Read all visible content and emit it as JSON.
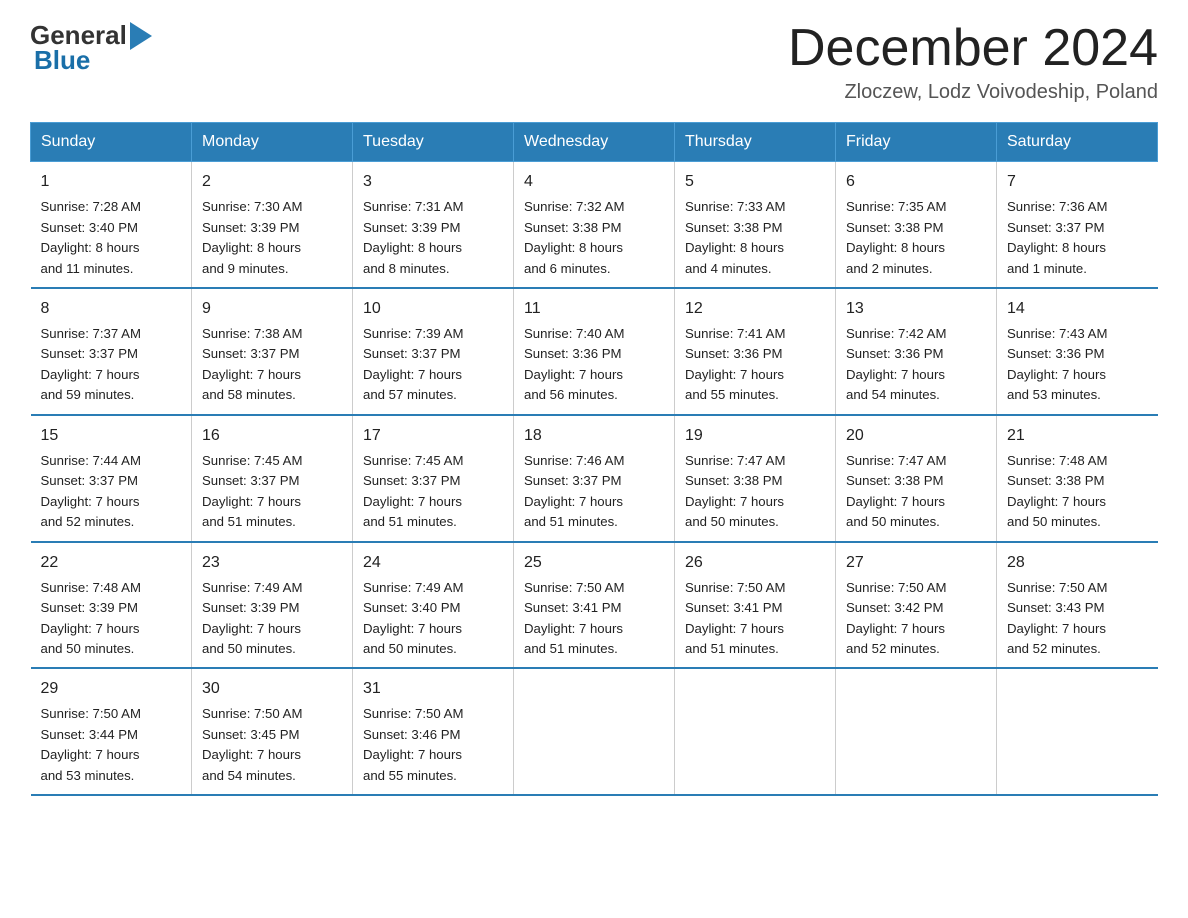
{
  "header": {
    "logo_general": "General",
    "logo_blue": "Blue",
    "month_title": "December 2024",
    "subtitle": "Zloczew, Lodz Voivodeship, Poland"
  },
  "columns": [
    "Sunday",
    "Monday",
    "Tuesday",
    "Wednesday",
    "Thursday",
    "Friday",
    "Saturday"
  ],
  "weeks": [
    [
      {
        "day": "1",
        "info": "Sunrise: 7:28 AM\nSunset: 3:40 PM\nDaylight: 8 hours\nand 11 minutes."
      },
      {
        "day": "2",
        "info": "Sunrise: 7:30 AM\nSunset: 3:39 PM\nDaylight: 8 hours\nand 9 minutes."
      },
      {
        "day": "3",
        "info": "Sunrise: 7:31 AM\nSunset: 3:39 PM\nDaylight: 8 hours\nand 8 minutes."
      },
      {
        "day": "4",
        "info": "Sunrise: 7:32 AM\nSunset: 3:38 PM\nDaylight: 8 hours\nand 6 minutes."
      },
      {
        "day": "5",
        "info": "Sunrise: 7:33 AM\nSunset: 3:38 PM\nDaylight: 8 hours\nand 4 minutes."
      },
      {
        "day": "6",
        "info": "Sunrise: 7:35 AM\nSunset: 3:38 PM\nDaylight: 8 hours\nand 2 minutes."
      },
      {
        "day": "7",
        "info": "Sunrise: 7:36 AM\nSunset: 3:37 PM\nDaylight: 8 hours\nand 1 minute."
      }
    ],
    [
      {
        "day": "8",
        "info": "Sunrise: 7:37 AM\nSunset: 3:37 PM\nDaylight: 7 hours\nand 59 minutes."
      },
      {
        "day": "9",
        "info": "Sunrise: 7:38 AM\nSunset: 3:37 PM\nDaylight: 7 hours\nand 58 minutes."
      },
      {
        "day": "10",
        "info": "Sunrise: 7:39 AM\nSunset: 3:37 PM\nDaylight: 7 hours\nand 57 minutes."
      },
      {
        "day": "11",
        "info": "Sunrise: 7:40 AM\nSunset: 3:36 PM\nDaylight: 7 hours\nand 56 minutes."
      },
      {
        "day": "12",
        "info": "Sunrise: 7:41 AM\nSunset: 3:36 PM\nDaylight: 7 hours\nand 55 minutes."
      },
      {
        "day": "13",
        "info": "Sunrise: 7:42 AM\nSunset: 3:36 PM\nDaylight: 7 hours\nand 54 minutes."
      },
      {
        "day": "14",
        "info": "Sunrise: 7:43 AM\nSunset: 3:36 PM\nDaylight: 7 hours\nand 53 minutes."
      }
    ],
    [
      {
        "day": "15",
        "info": "Sunrise: 7:44 AM\nSunset: 3:37 PM\nDaylight: 7 hours\nand 52 minutes."
      },
      {
        "day": "16",
        "info": "Sunrise: 7:45 AM\nSunset: 3:37 PM\nDaylight: 7 hours\nand 51 minutes."
      },
      {
        "day": "17",
        "info": "Sunrise: 7:45 AM\nSunset: 3:37 PM\nDaylight: 7 hours\nand 51 minutes."
      },
      {
        "day": "18",
        "info": "Sunrise: 7:46 AM\nSunset: 3:37 PM\nDaylight: 7 hours\nand 51 minutes."
      },
      {
        "day": "19",
        "info": "Sunrise: 7:47 AM\nSunset: 3:38 PM\nDaylight: 7 hours\nand 50 minutes."
      },
      {
        "day": "20",
        "info": "Sunrise: 7:47 AM\nSunset: 3:38 PM\nDaylight: 7 hours\nand 50 minutes."
      },
      {
        "day": "21",
        "info": "Sunrise: 7:48 AM\nSunset: 3:38 PM\nDaylight: 7 hours\nand 50 minutes."
      }
    ],
    [
      {
        "day": "22",
        "info": "Sunrise: 7:48 AM\nSunset: 3:39 PM\nDaylight: 7 hours\nand 50 minutes."
      },
      {
        "day": "23",
        "info": "Sunrise: 7:49 AM\nSunset: 3:39 PM\nDaylight: 7 hours\nand 50 minutes."
      },
      {
        "day": "24",
        "info": "Sunrise: 7:49 AM\nSunset: 3:40 PM\nDaylight: 7 hours\nand 50 minutes."
      },
      {
        "day": "25",
        "info": "Sunrise: 7:50 AM\nSunset: 3:41 PM\nDaylight: 7 hours\nand 51 minutes."
      },
      {
        "day": "26",
        "info": "Sunrise: 7:50 AM\nSunset: 3:41 PM\nDaylight: 7 hours\nand 51 minutes."
      },
      {
        "day": "27",
        "info": "Sunrise: 7:50 AM\nSunset: 3:42 PM\nDaylight: 7 hours\nand 52 minutes."
      },
      {
        "day": "28",
        "info": "Sunrise: 7:50 AM\nSunset: 3:43 PM\nDaylight: 7 hours\nand 52 minutes."
      }
    ],
    [
      {
        "day": "29",
        "info": "Sunrise: 7:50 AM\nSunset: 3:44 PM\nDaylight: 7 hours\nand 53 minutes."
      },
      {
        "day": "30",
        "info": "Sunrise: 7:50 AM\nSunset: 3:45 PM\nDaylight: 7 hours\nand 54 minutes."
      },
      {
        "day": "31",
        "info": "Sunrise: 7:50 AM\nSunset: 3:46 PM\nDaylight: 7 hours\nand 55 minutes."
      },
      {
        "day": "",
        "info": ""
      },
      {
        "day": "",
        "info": ""
      },
      {
        "day": "",
        "info": ""
      },
      {
        "day": "",
        "info": ""
      }
    ]
  ]
}
